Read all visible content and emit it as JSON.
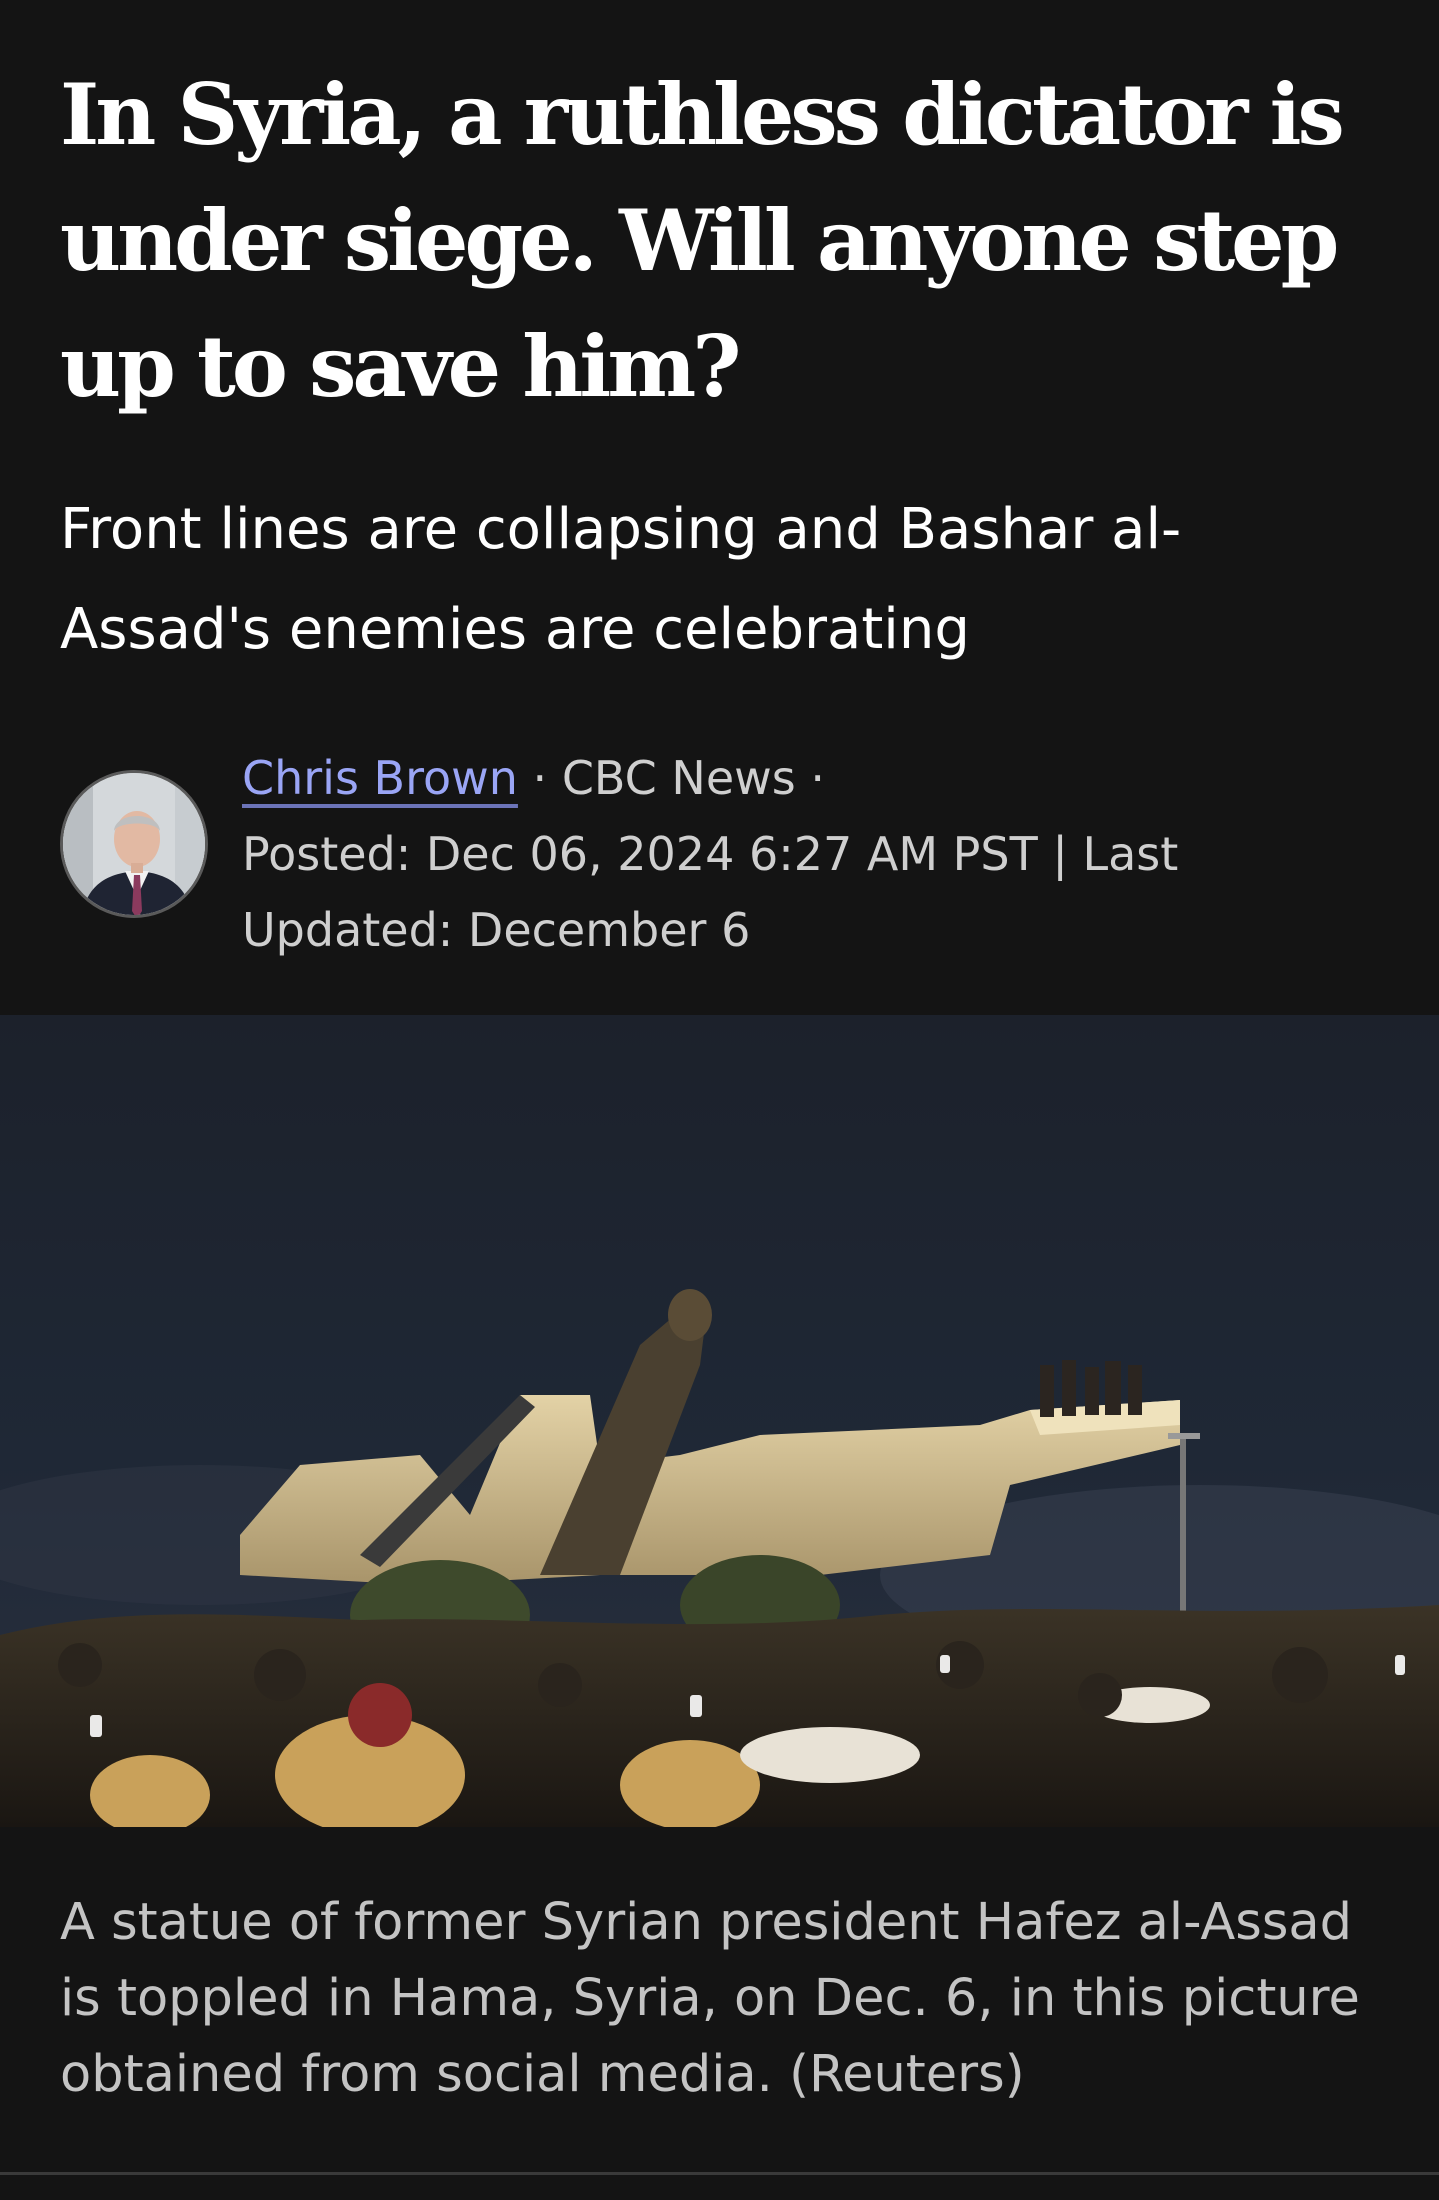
{
  "article": {
    "headline": "In Syria, a ruthless dictator is under siege. Will anyone step up to save him?",
    "deck": "Front lines are collapsing and Bashar al-Assad's enemies are celebrating",
    "byline": {
      "author": "Chris Brown",
      "separator_1": " · ",
      "outlet": "CBC News",
      "separator_2": " · ",
      "posted": "Posted: Dec 06, 2024 6:27 AM PST | Last Updated: December 6"
    },
    "photo": {
      "caption": "A statue of former Syrian president Hafez al-Assad is toppled in Hama, Syria, on Dec. 6, in this picture obtained from social media. (Reuters)"
    }
  },
  "colors": {
    "background": "#141414",
    "link": "#9aa5f5",
    "meta_text": "#cfcfcf",
    "caption_text": "#c4c4c4"
  },
  "icons": {
    "avatar": "author-portrait"
  }
}
